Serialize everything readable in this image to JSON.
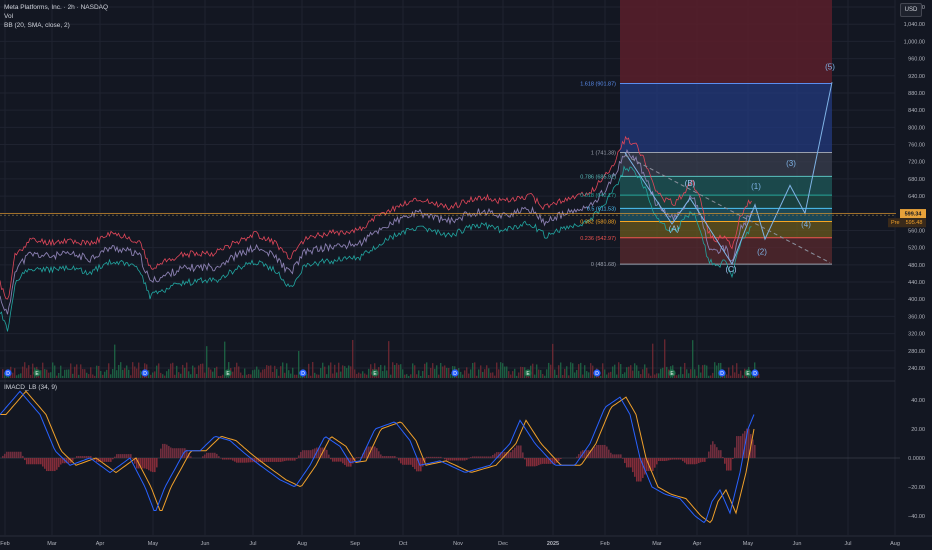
{
  "header": {
    "symbol_line": "Meta Platforms, Inc. · 2h · NASDAQ",
    "vol_label": "Vol",
    "bb_label": "BB (20, SMA, close, 2)",
    "currency": "USD"
  },
  "indicator": {
    "label": "IMACD_LB (34, 9)"
  },
  "colors": {
    "background": "#131722",
    "grid": "#1f2330",
    "price_line": "#f0a02a",
    "bb_upper": "#e0475a",
    "bb_lower": "#21a5a0",
    "wave": "#4a90d9",
    "macd_line": "#2962ff",
    "signal_line": "#f0a02a",
    "hist_neg": "#8f2f3c",
    "fib_618_zone": "#2a3d8a",
    "fib_top_zone": "#5a1e2a"
  },
  "price_axis": {
    "ticks": [
      "1,080.00",
      "1,040.00",
      "1,000.00",
      "960.00",
      "920.00",
      "880.00",
      "840.00",
      "800.00",
      "760.00",
      "720.00",
      "680.00",
      "640.00",
      "600.00",
      "560.00",
      "520.00",
      "480.00",
      "440.00",
      "400.00",
      "360.00",
      "320.00",
      "280.00",
      "240.00"
    ],
    "last_price": "599.34",
    "pre_label": "Pre",
    "pre_price": "595.48"
  },
  "indicator_axis": {
    "ticks": [
      "40.00",
      "20.00",
      "0.0000",
      "−20.00",
      "−40.00"
    ]
  },
  "time_axis": {
    "labels": [
      "Feb",
      "Mar",
      "Apr",
      "May",
      "Jun",
      "Jul",
      "Aug",
      "Sep",
      "Oct",
      "Nov",
      "Dec",
      "2025",
      "Feb",
      "Mar",
      "Apr",
      "May",
      "Jun",
      "Jul",
      "Aug"
    ]
  },
  "fib_levels": [
    {
      "label": "1.618 (901.87)",
      "value": 901.87,
      "color": "#5b8ef0"
    },
    {
      "label": "1 (741.38)",
      "value": 741.38,
      "color": "#9aa0ad"
    },
    {
      "label": "0.786 (685.92)",
      "value": 685.92,
      "color": "#5bc0be"
    },
    {
      "label": "0.618 (642.17)",
      "value": 642.17,
      "color": "#26a69a"
    },
    {
      "label": "0.5 (611.53)",
      "value": 611.53,
      "color": "#4fc3f7"
    },
    {
      "label": "0.382 (580.88)",
      "value": 580.88,
      "color": "#f6a623"
    },
    {
      "label": "0.236 (542.97)",
      "value": 542.97,
      "color": "#ef5350"
    },
    {
      "label": "0 (481.68)",
      "value": 481.68,
      "color": "#9aa0ad"
    }
  ],
  "wave_labels": [
    {
      "text": "(5)",
      "kind": "impulse"
    },
    {
      "text": "(3)",
      "kind": "impulse"
    },
    {
      "text": "(4)",
      "kind": "impulse"
    },
    {
      "text": "(1)",
      "kind": "impulse"
    },
    {
      "text": "(2)",
      "kind": "impulse"
    },
    {
      "text": "(B)",
      "kind": "correction"
    },
    {
      "text": "(A)",
      "kind": "correction"
    },
    {
      "text": "(C)",
      "kind": "correction"
    }
  ],
  "event_markers": [
    "D",
    "E",
    "D",
    "E",
    "D",
    "E",
    "D",
    "E",
    "D",
    "E",
    "D",
    "E",
    "D"
  ]
}
